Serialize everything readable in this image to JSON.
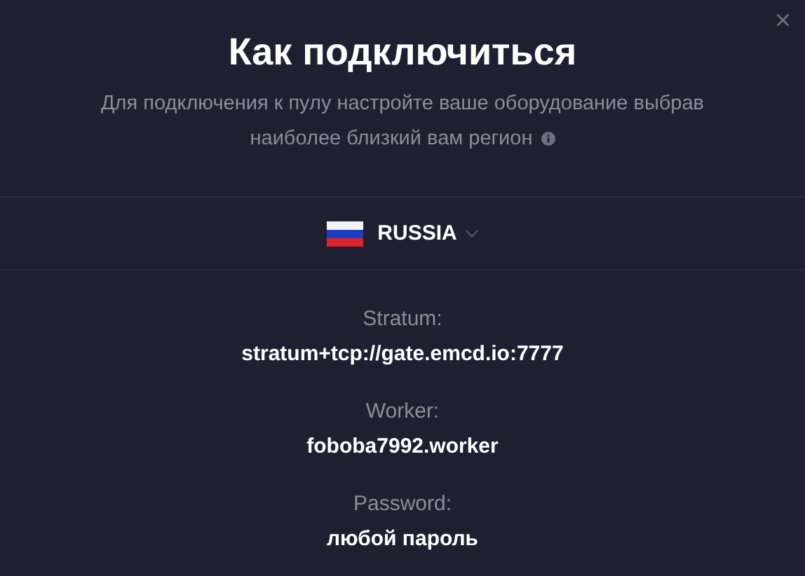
{
  "dialog": {
    "close_label": "×",
    "title": "Как подключиться",
    "subtitle": "Для подключения к пулу настройте ваше оборудование выбрав наиболее близкий вам регион"
  },
  "region": {
    "name": "RUSSIA"
  },
  "fields": [
    {
      "label": "Stratum:",
      "value": "stratum+tcp://gate.emcd.io:7777"
    },
    {
      "label": "Worker:",
      "value": "foboba7992.worker"
    },
    {
      "label": "Password:",
      "value": "любой пароль"
    }
  ]
}
